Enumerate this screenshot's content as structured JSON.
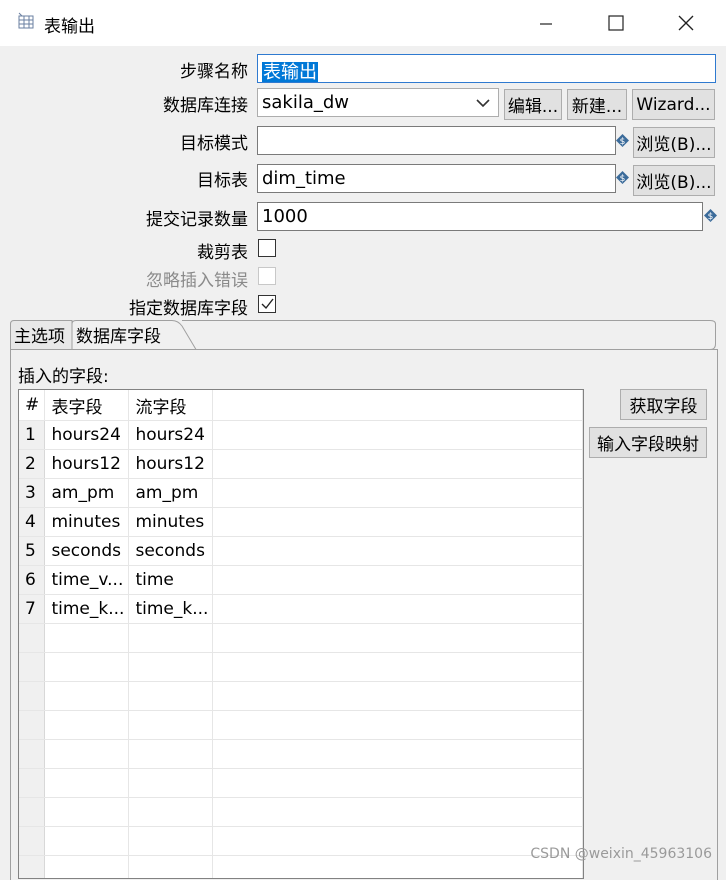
{
  "window": {
    "title": "表输出",
    "icon": "table-icon"
  },
  "form": {
    "step_name_label": "步骤名称",
    "step_name_value": "表输出",
    "db_connection_label": "数据库连接",
    "db_connection_value": "sakila_dw",
    "edit_button": "编辑...",
    "new_button": "新建...",
    "wizard_button": "Wizard...",
    "target_schema_label": "目标模式",
    "target_schema_value": "",
    "browse_button": "浏览(B)...",
    "target_table_label": "目标表",
    "target_table_value": "dim_time",
    "commit_size_label": "提交记录数量",
    "commit_size_value": "1000",
    "truncate_label": "裁剪表",
    "truncate_checked": false,
    "ignore_errors_label": "忽略插入错误",
    "ignore_errors_checked": false,
    "specify_fields_label": "指定数据库字段",
    "specify_fields_checked": true
  },
  "tabs": {
    "main": "主选项",
    "db_fields": "数据库字段",
    "active": "db_fields"
  },
  "fields_panel": {
    "insert_fields_label": "插入的字段:",
    "get_fields_button": "获取字段",
    "input_mapping_button": "输入字段映射",
    "columns": [
      "#",
      "表字段",
      "流字段"
    ],
    "rows": [
      [
        "1",
        "hours24",
        "hours24"
      ],
      [
        "2",
        "hours12",
        "hours12"
      ],
      [
        "3",
        "am_pm",
        "am_pm"
      ],
      [
        "4",
        "minutes",
        "minutes"
      ],
      [
        "5",
        "seconds",
        "seconds"
      ],
      [
        "6",
        "time_v...",
        "time"
      ],
      [
        "7",
        "time_k...",
        "time_k..."
      ]
    ]
  },
  "watermark": "CSDN @weixin_45963106"
}
